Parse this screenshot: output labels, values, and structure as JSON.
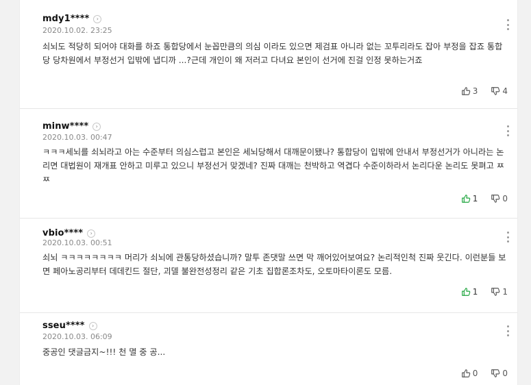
{
  "comments": [
    {
      "username": "mdy1****",
      "date": "2020.10.02. 23:25",
      "text": "쇠뇌도 적당히 되어야 대화를 하죠 통합당에서 눈꼽만큼의 의심 이라도 있으면 제검표 아니라 없는 꼬투리라도 잡아 부정을 잡죠 통합당 당차원에서 부정선거 입밖에 냅디까 ...?근데 개인이 왜 저러고 다녀요 본인이 선거에 진걸 인정 못하는거죠",
      "likes": "3",
      "dislikes": "4",
      "like_active": false
    },
    {
      "username": "minw****",
      "date": "2020.10.03. 00:47",
      "text": "ㅋㅋㅋ세뇌를 쇠뇌라고 아는 수준부터 의심스럽고 본인은 세뇌당해서 대깨문이됐나? 통합당이 입밖에 안내서 부정선거가 아니라는 논리면 대법원이 재개표 안하고 미루고 있으니 부정선거 맞겠네? 진짜 대깨는 천박하고 역겹다 수준이하라서 논리다운 논리도 못펴고 ㅉㅉ",
      "likes": "1",
      "dislikes": "0",
      "like_active": true
    },
    {
      "username": "vbio****",
      "date": "2020.10.03. 00:51",
      "text": "쇠뇌 ㅋㅋㅋㅋㅋㅋㅋㅋ 머리가 쇠뇌에 관통당하셨습니까? 말투 존댓말 쓰면 막 깨어있어보여요? 논리적인척 진짜 웃긴다. 이런분들 보면 페아노공리부터 데데킨드 절단, 괴델 불완전성정리 같은 기초 집합론조차도, 오토마타이론도 모름.",
      "likes": "1",
      "dislikes": "1",
      "like_active": true
    },
    {
      "username": "sseu****",
      "date": "2020.10.03. 06:09",
      "text": "중공인 댓글금지~!!! 천 멸 중 공...",
      "likes": "0",
      "dislikes": "0",
      "like_active": false
    }
  ],
  "icons": {
    "profile": "chevron-right-circle-icon",
    "more": "vertical-ellipsis-icon",
    "like": "thumbs-up-icon",
    "dislike": "thumbs-down-icon"
  },
  "colors": {
    "like_active": "#1aa33a",
    "icon_default": "#555555",
    "username": "#111111",
    "date": "#888888"
  }
}
